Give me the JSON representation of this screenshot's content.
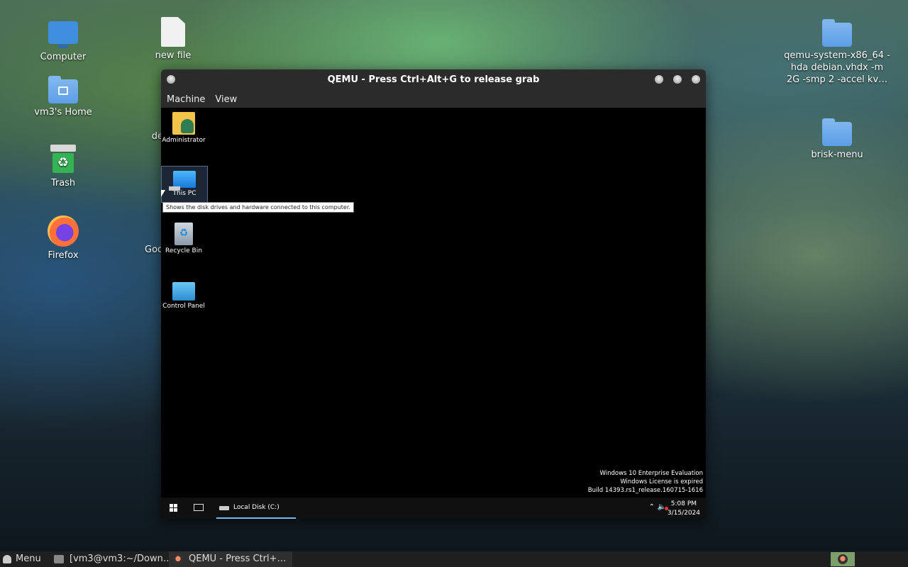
{
  "desktop": {
    "icons_left": [
      {
        "label": "Computer",
        "icon": "computer-icon"
      },
      {
        "label": "new file",
        "icon": "file-icon"
      },
      {
        "label": "vm3's Home",
        "icon": "home-folder-icon"
      },
      {
        "label": "Trash",
        "icon": "trash-icon"
      },
      {
        "label": "Firefox",
        "icon": "firefox-icon"
      }
    ],
    "partial_labels": {
      "behind_window_1": "de",
      "behind_window_2": "Goo"
    },
    "icons_right": [
      {
        "label": "qemu-system-x86_64 -hda debian.vhdx -m 2G -smp 2 -accel kv…",
        "icon": "folder-icon"
      },
      {
        "label": "brisk-menu",
        "icon": "folder-icon"
      }
    ]
  },
  "qemu_window": {
    "title": "QEMU - Press Ctrl+Alt+G to release grab",
    "menu": [
      "Machine",
      "View"
    ]
  },
  "guest": {
    "desktop_icons": [
      {
        "label": "Administrator",
        "icon": "user-folder-icon"
      },
      {
        "label": "This PC",
        "icon": "this-pc-icon"
      },
      {
        "label": "Recycle Bin",
        "icon": "recycle-bin-icon"
      },
      {
        "label": "Control Panel",
        "icon": "control-panel-icon"
      }
    ],
    "tooltip": "Shows the disk drives and hardware connected to this computer.",
    "watermark": [
      "Windows 10 Enterprise Evaluation",
      "Windows License is expired",
      "Build 14393.rs1_release.160715-1616"
    ],
    "taskbar": {
      "app_label": "Local Disk (C:)",
      "time": "5:08 PM",
      "date": "3/15/2024"
    }
  },
  "host_panel": {
    "menu_label": "Menu",
    "tasks": [
      {
        "label": "[vm3@vm3:~/Down…",
        "icon": "terminal-icon"
      },
      {
        "label": "QEMU - Press Ctrl+…",
        "icon": "qemu-icon"
      }
    ]
  }
}
